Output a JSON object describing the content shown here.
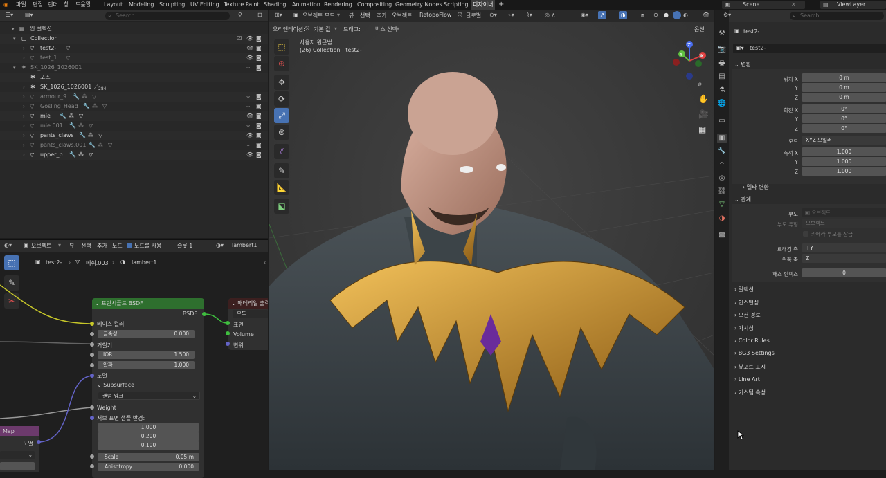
{
  "topbar": {
    "menus": [
      "파일",
      "편집",
      "렌더",
      "창",
      "도움말"
    ],
    "workspaces": [
      "Layout",
      "Modeling",
      "Sculpting",
      "UV Editing",
      "Texture Paint",
      "Shading",
      "Animation",
      "Rendering",
      "Compositing",
      "Geometry Nodes",
      "Scripting",
      "디자이너"
    ],
    "active_workspace": "디자이너",
    "add_tab": "+",
    "scene": "Scene",
    "view_layer": "ViewLayer"
  },
  "outliner": {
    "search_placeholder": "Search",
    "rows": [
      {
        "label": "씬 컬렉션",
        "extra": ""
      },
      {
        "label": "Collection",
        "extra": ""
      },
      {
        "label": "test2-",
        "extra": ""
      },
      {
        "label": "test_1",
        "extra": ""
      },
      {
        "label": "SK_1026_1026001",
        "extra": ""
      },
      {
        "label": "포즈",
        "extra": ""
      },
      {
        "label": "SK_1026_1026001",
        "extra": "284"
      },
      {
        "label": "armour_9",
        "extra": ""
      },
      {
        "label": "Gosling_Head",
        "extra": ""
      },
      {
        "label": "mie",
        "extra": ""
      },
      {
        "label": "mie.001",
        "extra": ""
      },
      {
        "label": "pants_claws",
        "extra": ""
      },
      {
        "label": "pants_claws.001",
        "extra": ""
      },
      {
        "label": "upper_b",
        "extra": ""
      }
    ]
  },
  "node_editor": {
    "header": {
      "mode": "오브젝트",
      "view": "뷰",
      "select": "선택",
      "add": "추가",
      "node": "노드",
      "use_nodes": "노드를 사용",
      "slot": "슬롯 1",
      "material": "lambert1"
    },
    "breadcrumb": {
      "object": "test2-",
      "mesh": "메쉬.003",
      "material": "lambert1"
    },
    "bsdf": {
      "title": "프린시플드 BSDF",
      "output": "BSDF",
      "base_color": "베이스 컬러",
      "metallic_label": "금속성",
      "metallic_value": "0.000",
      "roughness": "거칠기",
      "ior_label": "IOR",
      "ior_value": "1.500",
      "alpha_label": "알파",
      "alpha_value": "1.000",
      "normal": "노멀",
      "subsurface": "Subsurface",
      "method": "랜덤 워크",
      "weight": "Weight",
      "radius_label": "서브 표면 샘플 반경:",
      "radius": [
        "1.000",
        "0.200",
        "0.100"
      ],
      "scale_label": "Scale",
      "scale_value": "0.05 m",
      "aniso_label": "Anisotropy",
      "aniso_value": "0.000"
    },
    "output": {
      "title": "매테리얼 출력",
      "target": "모두",
      "surface": "표면",
      "volume": "Volume",
      "displacement": "변위"
    },
    "mapnode": {
      "title": "Map",
      "normal": "노멀"
    }
  },
  "viewport": {
    "header": {
      "mode": "오브젝트 모드",
      "view": "뷰",
      "select": "선택",
      "add": "추가",
      "object": "오브젝트",
      "addon": "RetopoFlow",
      "transform": "글로벌"
    },
    "sub": {
      "orient_label": "오리엔테이션:",
      "orient_value": "기본 값",
      "drag_label": "드래그:",
      "drag_value": "박스 선택",
      "options": "옵션"
    },
    "overlay_title": "사용자 원근법",
    "overlay_collection": "(26) Collection | test2-",
    "gizmo": {
      "x": "X",
      "y": "Y",
      "z": "Z"
    }
  },
  "properties": {
    "search_placeholder": "Search",
    "object_name": "test2-",
    "object_field": "test2-",
    "transform_title": "변환",
    "location": {
      "x_label": "위치 X",
      "y_label": "Y",
      "z_label": "Z",
      "x": "0 m",
      "y": "0 m",
      "z": "0 m"
    },
    "rotation": {
      "x_label": "회전 X",
      "y_label": "Y",
      "z_label": "Z",
      "x": "0°",
      "y": "0°",
      "z": "0°"
    },
    "mode_label": "모드",
    "mode_value": "XYZ 오일러",
    "scale": {
      "x_label": "축적 X",
      "y_label": "Y",
      "z_label": "Z",
      "x": "1.000",
      "y": "1.000",
      "z": "1.000"
    },
    "delta": "델타 변환",
    "relations_title": "관계",
    "parent_label": "부모",
    "parent_value": "오브젝트",
    "parent_type_label": "부모 유형",
    "parent_type_value": "오브젝트",
    "camera_lock": "카메라 부모를 잠금",
    "track_label": "트래킹 축",
    "track_value": "+Y",
    "up_label": "위쪽 축",
    "up_value": "Z",
    "pass_label": "패스 인덱스",
    "pass_value": "0",
    "sections": [
      "컬렉션",
      "인스턴싱",
      "모션 경로",
      "가시성",
      "Color Rules",
      "BG3 Settings",
      "뷰포트 표시",
      "Line Art",
      "커스텀 속성"
    ]
  },
  "colors": {
    "accent": "#4772b3",
    "node_header_green": "#2e6f2e",
    "yellow_link": "#c7c729",
    "purple_link": "#6363c7"
  }
}
